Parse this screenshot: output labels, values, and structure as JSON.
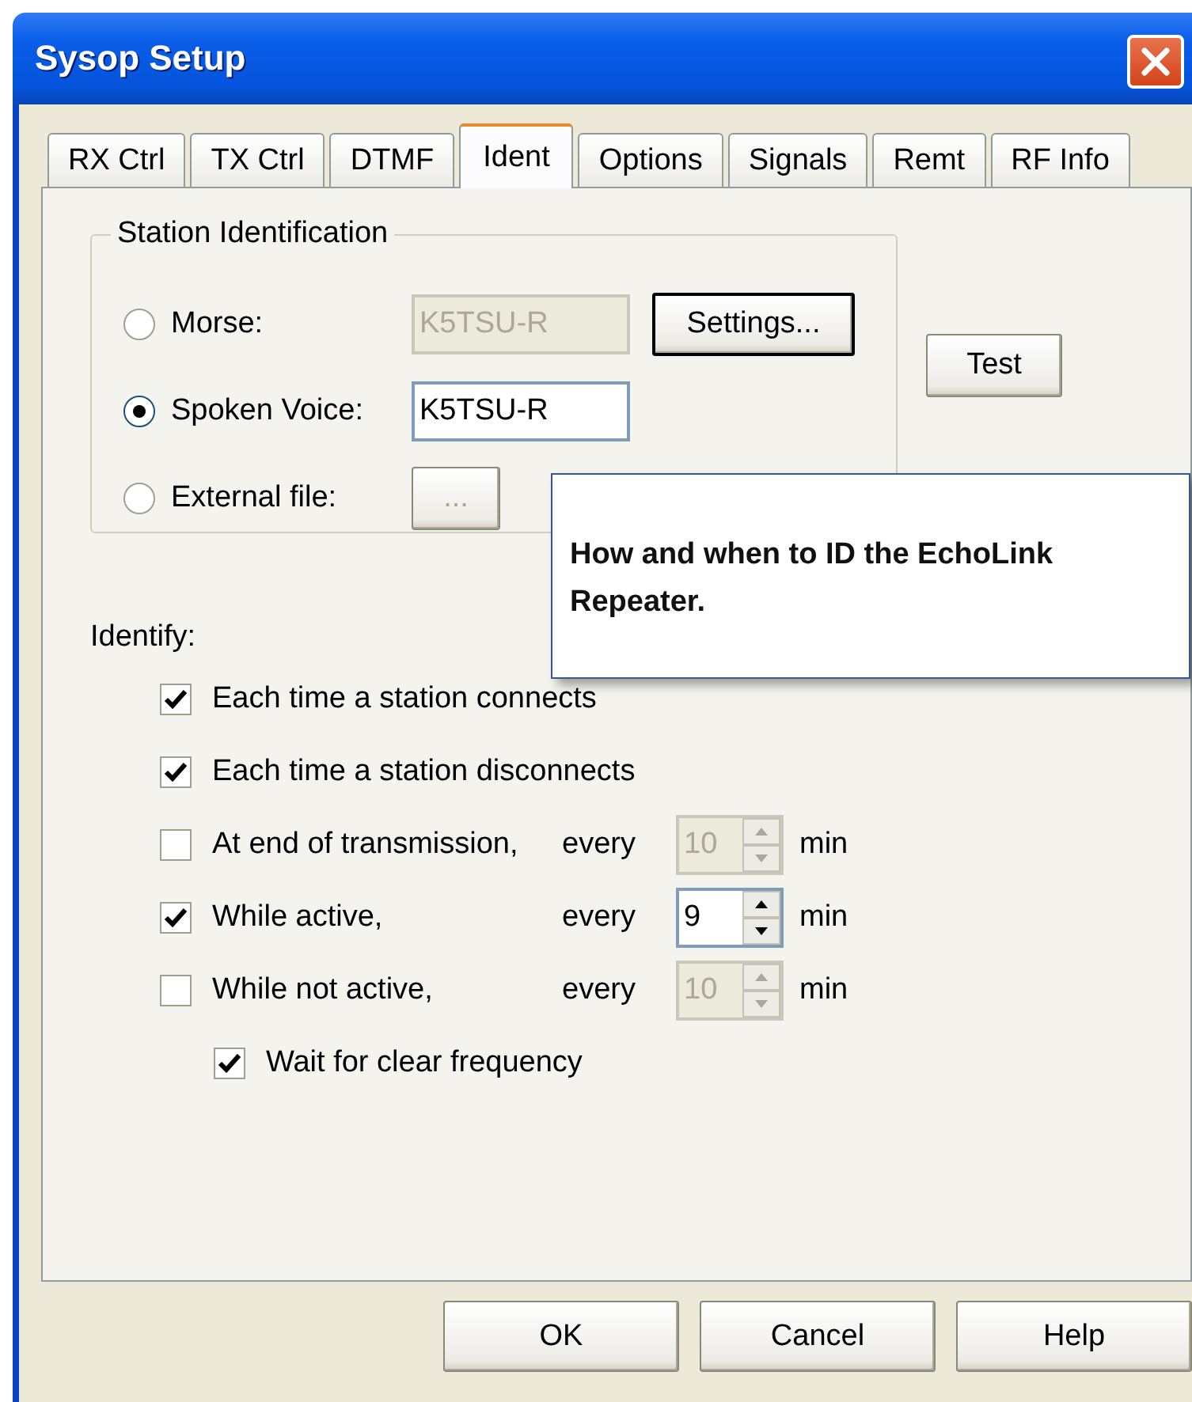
{
  "window": {
    "title": "Sysop Setup"
  },
  "tabs": [
    {
      "label": "RX Ctrl",
      "selected": false
    },
    {
      "label": "TX Ctrl",
      "selected": false
    },
    {
      "label": "DTMF",
      "selected": false
    },
    {
      "label": "Ident",
      "selected": true
    },
    {
      "label": "Options",
      "selected": false
    },
    {
      "label": "Signals",
      "selected": false
    },
    {
      "label": "Remt",
      "selected": false
    },
    {
      "label": "RF Info",
      "selected": false
    }
  ],
  "station_identification": {
    "title": "Station Identification",
    "options": [
      {
        "kind": "field",
        "label": "Morse:",
        "selected": false,
        "value": "K5TSU-R",
        "disabled": true,
        "button": "Settings..."
      },
      {
        "kind": "field",
        "label": "Spoken Voice:",
        "selected": true,
        "value": "K5TSU-R",
        "disabled": false
      },
      {
        "kind": "browse",
        "label": "External file:",
        "selected": false,
        "button": "...",
        "disabled": true
      }
    ]
  },
  "test_button": "Test",
  "tooltip": "How and when to ID the EchoLink Repeater.",
  "identify": {
    "label": "Identify:",
    "options": [
      {
        "kind": "plain",
        "label": "Each time a station connects",
        "checked": true
      },
      {
        "kind": "plain",
        "label": "Each time a station disconnects",
        "checked": true
      },
      {
        "kind": "interval",
        "label": "At end of transmission,",
        "checked": false,
        "every": "every",
        "value": "10",
        "unit": "min",
        "disabled": true
      },
      {
        "kind": "interval",
        "label": "While active,",
        "checked": true,
        "every": "every",
        "value": "9",
        "unit": "min",
        "disabled": false
      },
      {
        "kind": "interval",
        "label": "While not active,",
        "checked": false,
        "every": "every",
        "value": "10",
        "unit": "min",
        "disabled": true
      }
    ],
    "wait": {
      "label": "Wait for clear frequency",
      "checked": true
    }
  },
  "buttons": [
    "OK",
    "Cancel",
    "Help"
  ]
}
